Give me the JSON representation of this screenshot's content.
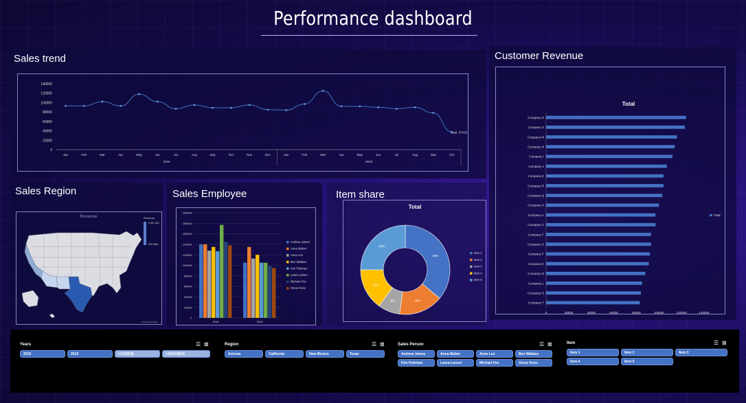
{
  "dashboard": {
    "title": "Performance dashboard"
  },
  "panels": {
    "sales_trend": "Sales trend",
    "customer_revenue": "Customer Revenue",
    "sales_region": "Sales Region",
    "sales_employee": "Sales Employee",
    "item_share": "Item share"
  },
  "colors": {
    "bar_blue": "#4472c4",
    "orange": "#ed7d31",
    "gray": "#a5a5a5",
    "yellow": "#ffc000",
    "light_blue": "#5b9bd5",
    "green": "#70ad47",
    "navy": "#264478",
    "dark_orange": "#9e480e",
    "pink": "#ff9da7"
  },
  "map": {
    "title": "Revenue",
    "legend_title": "Revenue",
    "legend_max": "3,82,185",
    "legend_min": "492,884",
    "attribution": "Powered by Bing"
  },
  "chart_data": [
    {
      "type": "line",
      "categories": [
        "Jan",
        "Feb",
        "Mar",
        "Apr",
        "May",
        "Jun",
        "Jul",
        "Aug",
        "Sep",
        "Oct",
        "Nov",
        "Dec",
        "Jan",
        "Feb",
        "Mar",
        "Apr",
        "May",
        "Jun",
        "Jul",
        "Aug",
        "Sep",
        "Oct"
      ],
      "groups": [
        {
          "label": "2018",
          "from": 0,
          "to": 11
        },
        {
          "label": "2019",
          "from": 12,
          "to": 21
        }
      ],
      "series": [
        {
          "values": [
            93000,
            93000,
            102000,
            93000,
            118000,
            102000,
            87000,
            95000,
            89000,
            89000,
            95000,
            85000,
            84000,
            97000,
            125000,
            92000,
            92000,
            90000,
            87000,
            90000,
            78000,
            37415
          ]
        }
      ],
      "yticks": [
        0,
        20000,
        40000,
        60000,
        80000,
        100000,
        120000,
        140000
      ],
      "ylim": [
        0,
        140000
      ],
      "end_label": "Total, 37415"
    },
    {
      "type": "bar",
      "title": "Total",
      "categories": [
        "Company D",
        "Company S",
        "Company M",
        "Company N",
        "Company I",
        "Company J",
        "Company E",
        "Company R",
        "Company Q",
        "Company H",
        "Company A",
        "Company C",
        "Company F",
        "Company G",
        "Company F",
        "Company K",
        "Company N",
        "Company L",
        "Company O",
        "Company T"
      ],
      "series": [
        {
          "name": "Total",
          "values": [
            124000,
            123000,
            116000,
            114000,
            112000,
            107000,
            104000,
            104000,
            103000,
            100000,
            97000,
            97000,
            93000,
            93000,
            92000,
            91000,
            88000,
            85000,
            84000,
            83000
          ]
        }
      ],
      "xticks": [
        0,
        20000,
        40000,
        60000,
        80000,
        100000,
        120000,
        140000
      ],
      "xlim": [
        0,
        140000
      ]
    },
    {
      "type": "bar",
      "categories": [
        "2018",
        "2019"
      ],
      "series": [
        {
          "name": "Andrew James",
          "values": [
            140000,
            105000
          ]
        },
        {
          "name": "Anna Weber",
          "values": [
            140000,
            135000
          ]
        },
        {
          "name": "Anne Lee",
          "values": [
            128000,
            113000
          ]
        },
        {
          "name": "Ben Wallace",
          "values": [
            135000,
            120000
          ]
        },
        {
          "name": "Kim Fishman",
          "values": [
            127000,
            105000
          ]
        },
        {
          "name": "Laura Larsen",
          "values": [
            177000,
            105000
          ]
        },
        {
          "name": "Michael Fox",
          "values": [
            145000,
            99000
          ]
        },
        {
          "name": "Oscar Knox",
          "values": [
            138000,
            95000
          ]
        }
      ],
      "yticks": [
        0,
        20000,
        40000,
        60000,
        80000,
        100000,
        120000,
        140000,
        160000,
        180000,
        200000
      ],
      "ylim": [
        0,
        200000
      ]
    },
    {
      "type": "pie",
      "title": "Total",
      "categories": [
        "Item 1",
        "Item 2",
        "Item 3",
        "Item 4",
        "Item 5"
      ],
      "values": [
        36,
        16,
        8,
        15,
        25
      ],
      "labels": [
        "36%",
        "16%",
        "8%",
        "15%",
        "25%"
      ]
    }
  ],
  "slicers": {
    "years": {
      "title": "Years",
      "items": [
        "2018",
        "2019",
        "<1/1/2018",
        ">10/17/2019"
      ]
    },
    "region": {
      "title": "Region",
      "items": [
        "Arizona",
        "California",
        "New Mexico",
        "Texas"
      ]
    },
    "sales_person": {
      "title": "Sales Person",
      "items": [
        "Andrew James",
        "Anna Weber",
        "Anne Lee",
        "Ben Wallace",
        "Kim Fishman",
        "Laura Larsen",
        "Michael Fox",
        "Oscar Knox"
      ]
    },
    "item": {
      "title": "Item",
      "items": [
        "Item 1",
        "Item 2",
        "Item 3",
        "Item 4",
        "Item 5"
      ]
    },
    "icons": {
      "multiselect": "☰",
      "clear_filter": "⊠"
    }
  }
}
